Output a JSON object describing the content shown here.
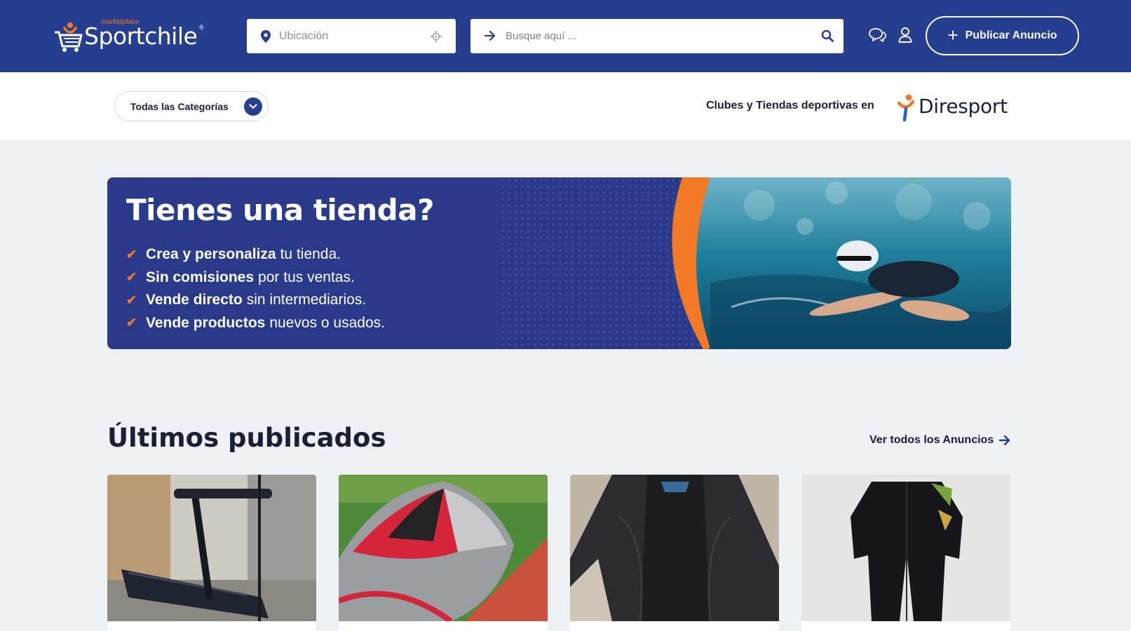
{
  "header": {
    "logo_text": "Sportchile",
    "logo_sub": "marketplace",
    "logo_reg": "®",
    "location_placeholder": "Ubicación",
    "search_placeholder": "Busque aquí ...",
    "publish_label": "Publicar Anuncio",
    "publish_icon": "plus-icon",
    "icons": [
      "map-pin-icon",
      "crosshair-icon",
      "arrow-right-icon",
      "search-icon",
      "chat-icon",
      "user-icon"
    ]
  },
  "subbar": {
    "categories_label": "Todas las Categorías",
    "clubs_text": "Clubes y Tiendas deportivas en",
    "partner_logo_text": "Diresport"
  },
  "banner": {
    "title": "Tienes una tienda?",
    "items": [
      {
        "strong": "Crea y personaliza",
        "rest": "tu tienda."
      },
      {
        "strong": "Sin comisiones",
        "rest": "por tus ventas."
      },
      {
        "strong": "Vende directo",
        "rest": "sin intermediarios."
      },
      {
        "strong": "Vende productos",
        "rest": "nuevos o usados."
      }
    ]
  },
  "latest": {
    "title": "Últimos publicados",
    "see_all": "Ver todos los Anuncios",
    "cards": [
      {
        "image": "treadmill-photo"
      },
      {
        "image": "kite-photo"
      },
      {
        "image": "wetsuit-flat-photo"
      },
      {
        "image": "wetsuit-hanging-photo"
      }
    ]
  },
  "colors": {
    "brand_blue": "#273e8f",
    "accent_orange": "#f07a26",
    "page_bg": "#eef1f5"
  }
}
